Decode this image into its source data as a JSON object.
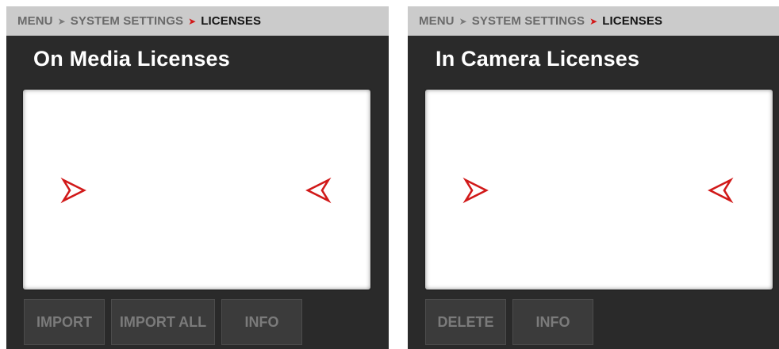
{
  "left_panel": {
    "breadcrumb": {
      "menu": "MENU",
      "section": "SYSTEM SETTINGS",
      "current": "LICENSES"
    },
    "title": "On Media Licenses",
    "buttons": {
      "import": "IMPORT",
      "import_all": "IMPORT ALL",
      "info": "INFO"
    }
  },
  "right_panel": {
    "breadcrumb": {
      "menu": "MENU",
      "section": "SYSTEM SETTINGS",
      "current": "LICENSES"
    },
    "title": "In Camera Licenses",
    "buttons": {
      "delete": "DELETE",
      "info": "INFO"
    }
  },
  "colors": {
    "background": "#2a2a2a",
    "breadcrumb_bar": "#cbcbcb",
    "accent_red": "#d11919",
    "button": "#3b3b3b",
    "button_text": "#7b7b7b"
  },
  "icons": {
    "breadcrumb_separator": "chevron-right-icon",
    "list_left_marker": "arrow-right-icon",
    "list_right_marker": "arrow-left-icon"
  }
}
